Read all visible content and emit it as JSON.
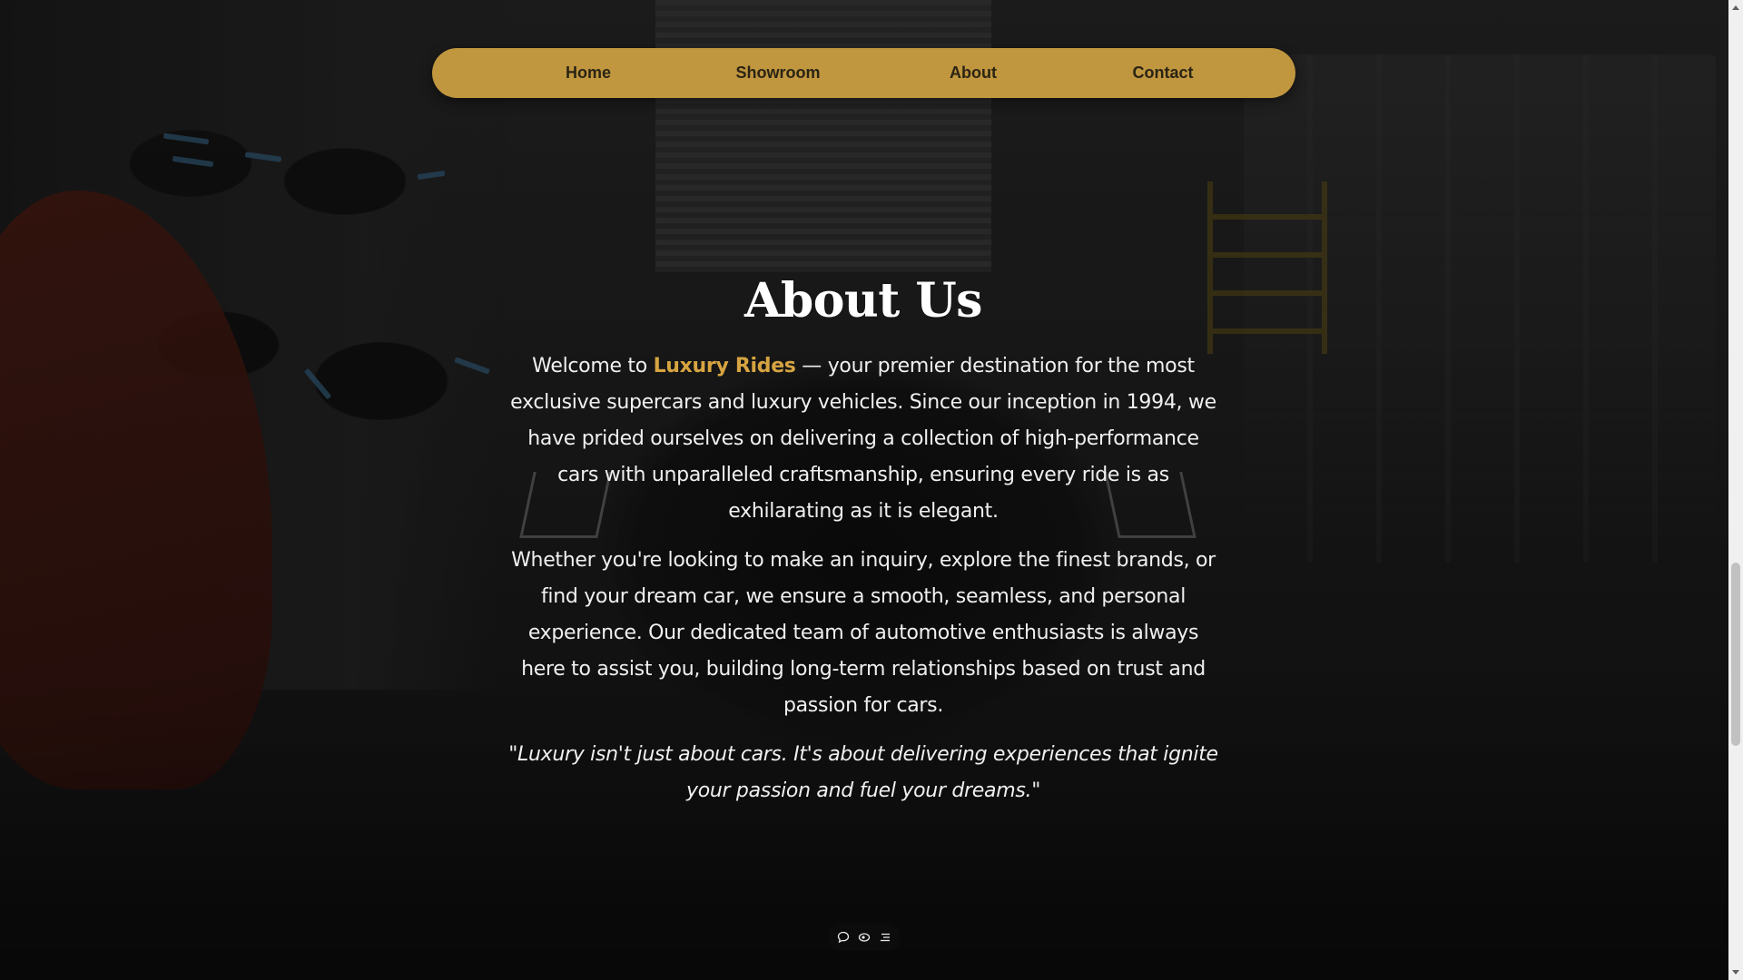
{
  "nav": {
    "items": [
      {
        "label": "Home"
      },
      {
        "label": "Showroom"
      },
      {
        "label": "About"
      },
      {
        "label": "Contact"
      }
    ]
  },
  "about": {
    "title": "About Us",
    "intro_prefix": "Welcome to ",
    "brand": "Luxury Rides",
    "intro_suffix": " — your premier destination for the most exclusive supercars and luxury vehicles. Since our inception in 1994, we have prided ourselves on delivering a collection of high-performance cars with unparalleled craftsmanship, ensuring every ride is as exhilarating as it is elegant.",
    "paragraph2": "Whether you're looking to make an inquiry, explore the finest brands, or find your dream car, we ensure a smooth, seamless, and personal experience. Our dedicated team of automotive enthusiasts is always here to assist you, building long-term relationships based on trust and passion for cars.",
    "quote": "\"Luxury isn't just about cars. It's about delivering experiences that ignite your passion and fuel your dreams.\""
  },
  "toolbar": {
    "icons": [
      "chat-icon",
      "eye-icon",
      "menu-icon"
    ]
  },
  "colors": {
    "nav_bg": "#c0963f",
    "brand_accent": "#d6a441",
    "text": "#f0f0f0"
  }
}
